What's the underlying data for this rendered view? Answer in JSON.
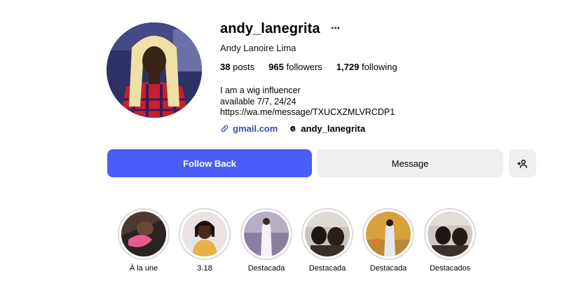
{
  "profile": {
    "username": "andy_lanegrita",
    "more_icon": "more-horizontal-icon",
    "full_name": "Andy Lanoire Lima",
    "stats": {
      "posts_count": "38",
      "posts_label": "posts",
      "followers_count": "965",
      "followers_label": "followers",
      "following_count": "1,729",
      "following_label": "following"
    },
    "bio": {
      "line1": "I am a wig influencer",
      "line2": "available 7/7, 24/24",
      "line3": "https://wa.me/message/TXUCXZMLVRCDP1"
    },
    "links": {
      "website": "gmail.com",
      "website_icon": "link-icon",
      "threads": "andy_lanegrita",
      "threads_icon": "threads-icon"
    }
  },
  "actions": {
    "follow_back": "Follow Back",
    "message": "Message",
    "add_user_icon": "add-person-icon"
  },
  "highlights": [
    {
      "label": "À la une"
    },
    {
      "label": "3.18"
    },
    {
      "label": "Destacada"
    },
    {
      "label": "Destacada"
    },
    {
      "label": "Destacada"
    },
    {
      "label": "Destacados"
    }
  ],
  "colors": {
    "primary_button": "#4a5df9",
    "secondary_button": "#efeff1",
    "link": "#3a4fa8",
    "highlight_ring": "#dbdbdb"
  }
}
